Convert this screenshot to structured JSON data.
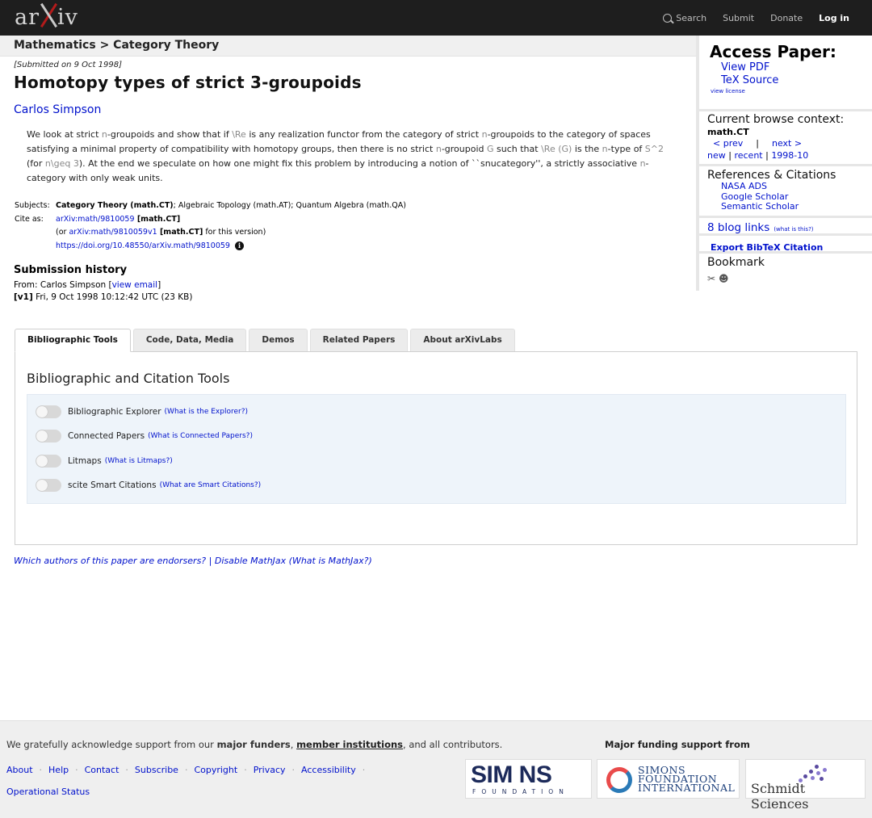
{
  "header": {
    "logo_ar": "ar",
    "logo_iv": "iv",
    "nav": {
      "search": "Search",
      "submit": "Submit",
      "donate": "Donate",
      "login": "Log in"
    }
  },
  "breadcrumb": "Mathematics > Category Theory",
  "paper": {
    "submitted": "[Submitted on 9 Oct 1998]",
    "title": "Homotopy types of strict 3-groupoids",
    "author": "Carlos Simpson",
    "abstract": {
      "p1": "We look at strict ",
      "m1": "n",
      "p2": "-groupoids and show that if ",
      "m2": "\\Re",
      "p3": " is any realization functor from the category of strict ",
      "m3": "n",
      "p4": "-groupoids to the category of spaces satisfying a minimal property of compatibility with homotopy groups, then there is no strict ",
      "m4": "n",
      "p5": "-groupoid ",
      "m5": "G",
      "p6": " such that ",
      "m6": "\\Re (G)",
      "p7": " is the ",
      "m7": "n",
      "p8": "-type of ",
      "m8": "S^2",
      "p9": " (for ",
      "m9": "n\\geq 3",
      "p10": "). At the end we speculate on how one might fix this problem by introducing a notion of ``snucategory'', a strictly associative ",
      "m10": "n",
      "p11": "-category with only weak units."
    },
    "subjects_label": "Subjects:",
    "subjects_primary": "Category Theory (math.CT)",
    "subjects_rest": "; Algebraic Topology (math.AT); Quantum Algebra (math.QA)",
    "cite_label": "Cite as:",
    "cite_id": "arXiv:math/9810059",
    "cite_cat": " [math.CT]",
    "cite_or_prefix": "(or ",
    "cite_v1": "arXiv:math/9810059v1",
    "cite_v1_cat": " [math.CT]",
    "cite_or_suffix": " for this version)",
    "doi": "https://doi.org/10.48550/arXiv.math/9810059",
    "history_title": "Submission history",
    "history_from": "From: Carlos Simpson [",
    "history_email": "view email",
    "history_from_end": "]",
    "history_v1": "[v1]",
    "history_v1_text": " Fri, 9 Oct 1998 10:12:42 UTC (23 KB)"
  },
  "tabs": [
    "Bibliographic Tools",
    "Code, Data, Media",
    "Demos",
    "Related Papers",
    "About arXivLabs"
  ],
  "panel": {
    "title": "Bibliographic and Citation Tools",
    "toggles": [
      {
        "label": "Bibliographic Explorer",
        "help": "(What is the Explorer?)"
      },
      {
        "label": "Connected Papers",
        "help": "(What is Connected Papers?)"
      },
      {
        "label": "Litmaps",
        "help": "(What is Litmaps?)"
      },
      {
        "label": "scite Smart Citations",
        "help": "(What are Smart Citations?)"
      }
    ]
  },
  "endorsers": {
    "q": "Which authors of this paper are endorsers?",
    "sep": " | ",
    "disable": "Disable MathJax",
    "what": " (What is MathJax?)"
  },
  "sidebar": {
    "access_title": "Access Paper:",
    "view_pdf": "View PDF",
    "tex_source": "TeX Source",
    "view_license": "view license",
    "context_title": "Current browse context:",
    "context_cat": "math.CT",
    "prev": "< prev",
    "pipe": "|",
    "next": "next >",
    "new": "new",
    "recent": "recent",
    "month": "1998-10",
    "refs_title": "References & Citations",
    "refs": [
      "NASA ADS",
      "Google Scholar",
      "Semantic Scholar"
    ],
    "blog": "8 blog links",
    "blog_what": "(what is this?)",
    "bibtex": "Export BibTeX Citation",
    "bookmark": "Bookmark"
  },
  "footer": {
    "ack_1": "We gratefully acknowledge support from our ",
    "ack_funders": "major funders",
    "ack_2": ", ",
    "ack_members": "member institutions",
    "ack_3": ", and all contributors.",
    "links": [
      "About",
      "Help",
      "Contact",
      "Subscribe",
      "Copyright",
      "Privacy",
      "Accessibility"
    ],
    "op_status": "Operational Status",
    "funding_title": "Major funding support from",
    "simons_big": "SIM  NS",
    "simons_small": "FOUNDATION",
    "sfi_l1": "SIMONS",
    "sfi_l2": "FOUNDATION",
    "sfi_l3": "INTERNATIONAL",
    "schmidt": "Schmidt Sciences"
  },
  "colors": {
    "topbar": "#1e1e1e",
    "link": "#0011cc",
    "logo_red": "#b31b1b"
  }
}
